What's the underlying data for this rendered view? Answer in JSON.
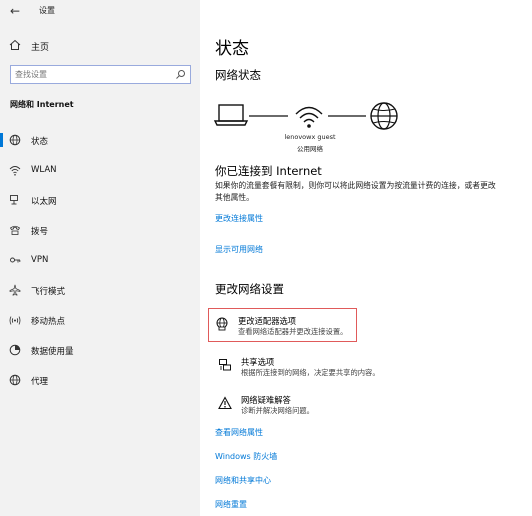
{
  "window": {
    "title": "设置",
    "back_icon": "back-arrow-icon"
  },
  "sidebar": {
    "home_label": "主页",
    "search": {
      "placeholder": "查找设置"
    },
    "section_label": "网络和 Internet",
    "items": [
      {
        "label": "状态",
        "icon": "status-globe-icon",
        "active": true
      },
      {
        "label": "WLAN",
        "icon": "wifi-icon"
      },
      {
        "label": "以太网",
        "icon": "ethernet-icon"
      },
      {
        "label": "拨号",
        "icon": "dialup-icon"
      },
      {
        "label": "VPN",
        "icon": "vpn-icon"
      },
      {
        "label": "飞行模式",
        "icon": "airplane-icon"
      },
      {
        "label": "移动热点",
        "icon": "hotspot-icon"
      },
      {
        "label": "数据使用量",
        "icon": "data-usage-icon"
      },
      {
        "label": "代理",
        "icon": "globe-icon"
      }
    ]
  },
  "main": {
    "title": "状态",
    "network_status_heading": "网络状态",
    "network_name": "lenovowx guest",
    "network_type": "公用网络",
    "connected_heading": "你已连接到 Internet",
    "connected_desc": "如果你的流量套餐有限制，则你可以将此网络设置为按流量计费的连接，或者更改其他属性。",
    "link_change_properties": "更改连接属性",
    "link_show_networks": "显示可用网络",
    "change_heading": "更改网络设置",
    "options": [
      {
        "title": "更改适配器选项",
        "desc": "查看网络适配器并更改连接设置。",
        "icon": "adapter-globe-icon"
      },
      {
        "title": "共享选项",
        "desc": "根据所连接到的网络，决定要共享的内容。",
        "icon": "sharing-icon"
      },
      {
        "title": "网络疑难解答",
        "desc": "诊断并解决网络问题。",
        "icon": "warning-icon"
      }
    ],
    "bottom_links": [
      "查看网络属性",
      "Windows 防火墙",
      "网络和共享中心",
      "网络重置"
    ]
  },
  "colors": {
    "accent": "#0078d7",
    "highlight_border": "#e05a5a",
    "sidebar_bg": "#f2f2f2"
  }
}
